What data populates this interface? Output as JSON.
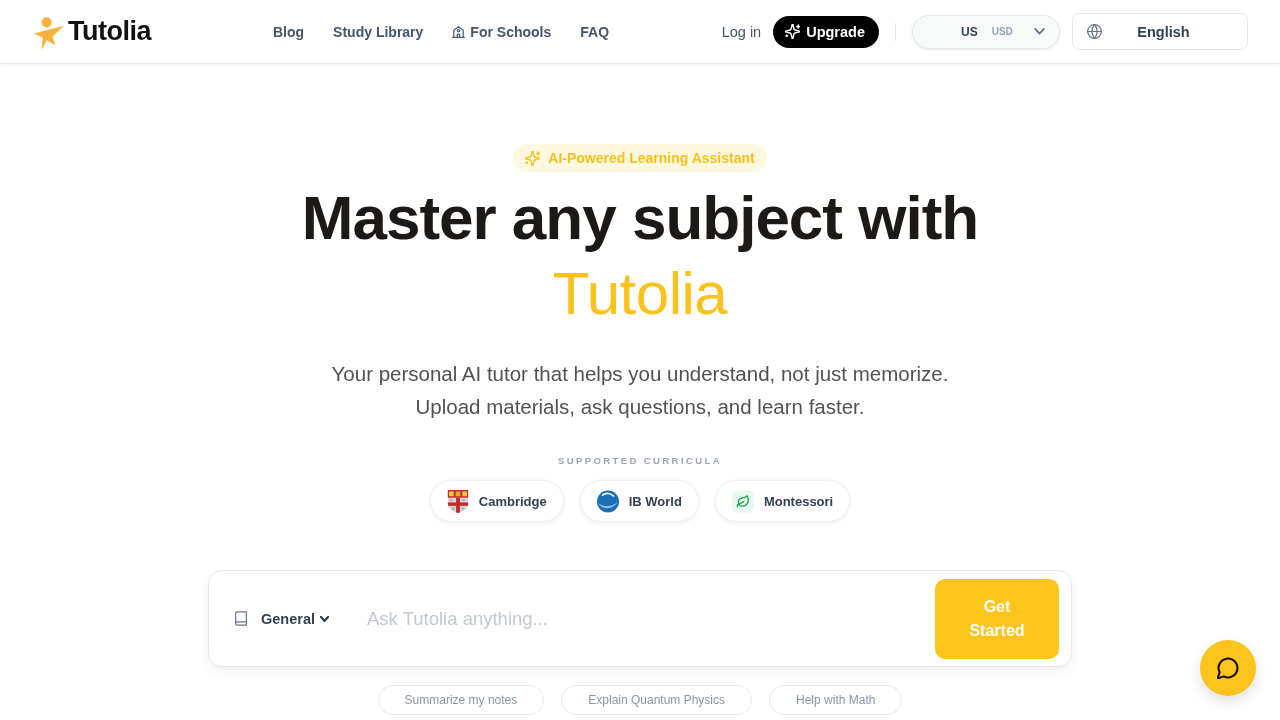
{
  "header": {
    "logo": "Tutolia",
    "nav": [
      {
        "label": "Blog",
        "kind": "link"
      },
      {
        "label": "Study Library",
        "kind": "link"
      },
      {
        "label": "For Schools",
        "kind": "icon-link"
      },
      {
        "label": "FAQ",
        "kind": "link"
      }
    ],
    "login": "Log in",
    "upgrade": "Upgrade",
    "currency": {
      "country": "US",
      "code": "USD"
    },
    "language": "English"
  },
  "hero": {
    "badge": "AI-Powered Learning Assistant",
    "title": "Master any subject with",
    "title_accent": "Tutolia",
    "subtitle": [
      "Your personal AI tutor that helps you understand, not just memorize.",
      "Upload materials, ask questions, and learn faster."
    ]
  },
  "curricula": {
    "heading": "SUPPORTED CURRICULA",
    "items": [
      {
        "label": "Cambridge",
        "kind": "crest"
      },
      {
        "label": "IB World",
        "kind": "disc"
      },
      {
        "label": "Montessori",
        "kind": "leaf"
      }
    ]
  },
  "ask": {
    "subject": "General",
    "placeholder": "Ask Tutolia anything...",
    "button": "Get Started"
  },
  "suggestions": [
    "Summarize my notes",
    "Explain Quantum Physics",
    "Help with Math"
  ]
}
